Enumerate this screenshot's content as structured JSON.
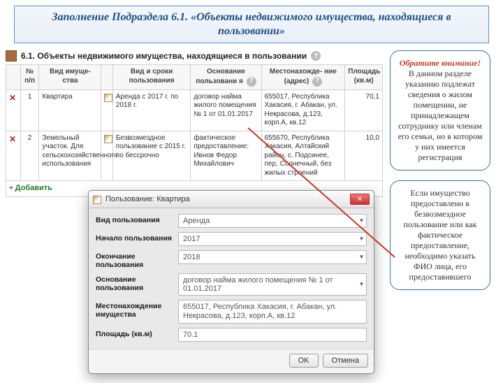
{
  "banner": {
    "title": "Заполнение Подраздела 6.1. «Объекты  недвижимого имущества, находящиеся в пользовании»"
  },
  "section": {
    "header": "6.1. Объекты недвижимого имущества, находящиеся в пользовании"
  },
  "table": {
    "cols": {
      "num": "№ п/п",
      "type": "Вид имуще-\nства",
      "term": "Вид и сроки пользования",
      "basis": "Основание пользовани\nя",
      "addr": "Местонахожде-\nние (адрес)",
      "area": "Площадь (кв.м)"
    },
    "rows": [
      {
        "num": "1",
        "type": "Квартира",
        "term": "Аренда с 2017 г. по 2018 г.",
        "basis": "договор найма жилого помещения № 1 от 01.01.2017",
        "addr": "655017, Республика Хакасия, г. Абакан, ул. Некрасова, д.123, корп.А, кв.12",
        "area": "70,1"
      },
      {
        "num": "2",
        "type": "Земельный участок. Для сельскохозяйственного использования",
        "term": "Безвозмездное пользование с 2015 г. по бессрочно",
        "basis": "фактическое предоставление: Ивнов Федор Михайлович",
        "addr": "655670, Республика Хакасия, Алтайский район, с. Подсинее, пер. Солнечный, без жилых строений",
        "area": "10,0"
      }
    ],
    "add": "Добавить"
  },
  "dialog": {
    "title": "Пользование: Квартира",
    "labels": {
      "kind": "Вид пользования",
      "start": "Начало пользования",
      "end": "Окончание пользования",
      "basis": "Основание пользования",
      "addr": "Местонахождение имущества",
      "area": "Площадь (кв.м)"
    },
    "values": {
      "kind": "Аренда",
      "start": "2017",
      "end": "2018",
      "basis": "договор найма жилого помещения № 1 от 01.01.2017",
      "addr": "655017, Республика Хакасия, г. Абакан, ул. Некрасова, д.123, корп.А, кв.12",
      "area": "70.1"
    },
    "buttons": {
      "ok": "OK",
      "cancel": "Отмена"
    }
  },
  "notes": {
    "attention_title": "Обратите внимание!",
    "attention_body": "В данном разделе указанию подлежат сведения о жилом помещении, не принадлежащем сотруднику или членам его семьи, но в котором у них имеется регистрация",
    "second": "Если имущество предоставлено в безвозмездное пользование или как фактическое предоставление, необходимо указать ФИО лица, его предоставившего"
  }
}
